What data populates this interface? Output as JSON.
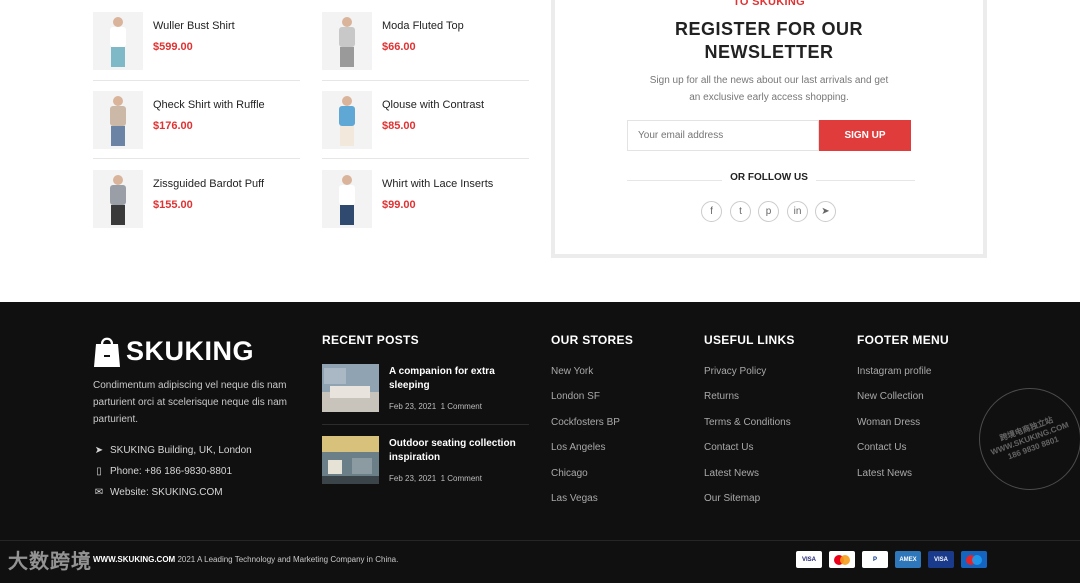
{
  "products": [
    {
      "name": "Wuller Bust Shirt",
      "price": "$599.00",
      "top_color": "#ffffff",
      "bottom_color": "#7fb8c6"
    },
    {
      "name": "Moda Fluted Top",
      "price": "$66.00",
      "top_color": "#c8c8c8",
      "bottom_color": "#9a9a9a"
    },
    {
      "name": "Qheck Shirt with Ruffle",
      "price": "$176.00",
      "top_color": "#cbb8a6",
      "bottom_color": "#6b84a6"
    },
    {
      "name": "Qlouse with Contrast",
      "price": "$85.00",
      "top_color": "#5fa8d6",
      "bottom_color": "#f2e8dc"
    },
    {
      "name": "Zissguided Bardot Puff",
      "price": "$155.00",
      "top_color": "#9a9ea6",
      "bottom_color": "#3a3a3a"
    },
    {
      "name": "Whirt with Lace Inserts",
      "price": "$99.00",
      "top_color": "#ffffff",
      "bottom_color": "#2f4a6e"
    }
  ],
  "newsletter": {
    "kicker": "TO SKUKING",
    "title_line1": "REGISTER FOR OUR",
    "title_line2": "NEWSLETTER",
    "desc_line1": "Sign up for all the news about our last arrivals and get",
    "desc_line2": "an exclusive early access shopping.",
    "email_placeholder": "Your email address",
    "button": "SIGN UP",
    "follow": "OR FOLLOW US",
    "social": [
      {
        "icon": "facebook-icon",
        "glyph": "f"
      },
      {
        "icon": "twitter-icon",
        "glyph": "t"
      },
      {
        "icon": "pinterest-icon",
        "glyph": "p"
      },
      {
        "icon": "linkedin-icon",
        "glyph": "in"
      },
      {
        "icon": "telegram-icon",
        "glyph": "➤"
      }
    ]
  },
  "footer": {
    "logo": "SKUKING",
    "about_lines": [
      "Condimentum adipiscing vel neque dis nam",
      "parturient orci at scelerisque neque dis nam",
      "parturient."
    ],
    "address": "SKUKING Building, UK, London",
    "phone": "Phone: +86 186-9830-8801",
    "website": "Website: SKUKING.COM",
    "recent_posts_title": "RECENT POSTS",
    "posts": [
      {
        "title_line1": "A companion for extra",
        "title_line2": "sleeping",
        "date": "Feb 23, 2021",
        "comments": "1 Comment"
      },
      {
        "title_line1": "Outdoor seating collection",
        "title_line2": "inspiration",
        "date": "Feb 23, 2021",
        "comments": "1 Comment"
      }
    ],
    "stores_title": "OUR STORES",
    "stores": [
      "New York",
      "London SF",
      "Cockfosters BP",
      "Los Angeles",
      "Chicago",
      "Las Vegas"
    ],
    "links_title": "USEFUL LINKS",
    "links": [
      "Privacy Policy",
      "Returns",
      "Terms & Conditions",
      "Contact Us",
      "Latest News",
      "Our Sitemap"
    ],
    "menu_title": "FOOTER MENU",
    "menu": [
      "Instagram profile",
      "New Collection",
      "Woman Dress",
      "Contact Us",
      "Latest News"
    ],
    "copyright_brand": "WWW.SKUKING.COM",
    "copyright_rest": "2021 A Leading Technology and Marketing Company in China.",
    "payments": [
      {
        "name": "VISA",
        "bg": "#ffffff",
        "fg": "#1a1f71"
      },
      {
        "name": "MC",
        "bg": "#ffffff",
        "fg": "#eb001b"
      },
      {
        "name": "PayPal",
        "bg": "#ffffff",
        "fg": "#003087"
      },
      {
        "name": "AMEX",
        "bg": "#2e77bb",
        "fg": "#ffffff"
      },
      {
        "name": "VISA Electron",
        "bg": "#1a3b8c",
        "fg": "#ffffff"
      },
      {
        "name": "Maestro",
        "bg": "#1565c0",
        "fg": "#ffffff"
      }
    ]
  },
  "watermark": {
    "left_text": "大数跨境",
    "stamp_line1": "跨境电商独立站",
    "stamp_line2": "WWW.SKUKING.COM",
    "stamp_line3": "186 9830 8801"
  }
}
